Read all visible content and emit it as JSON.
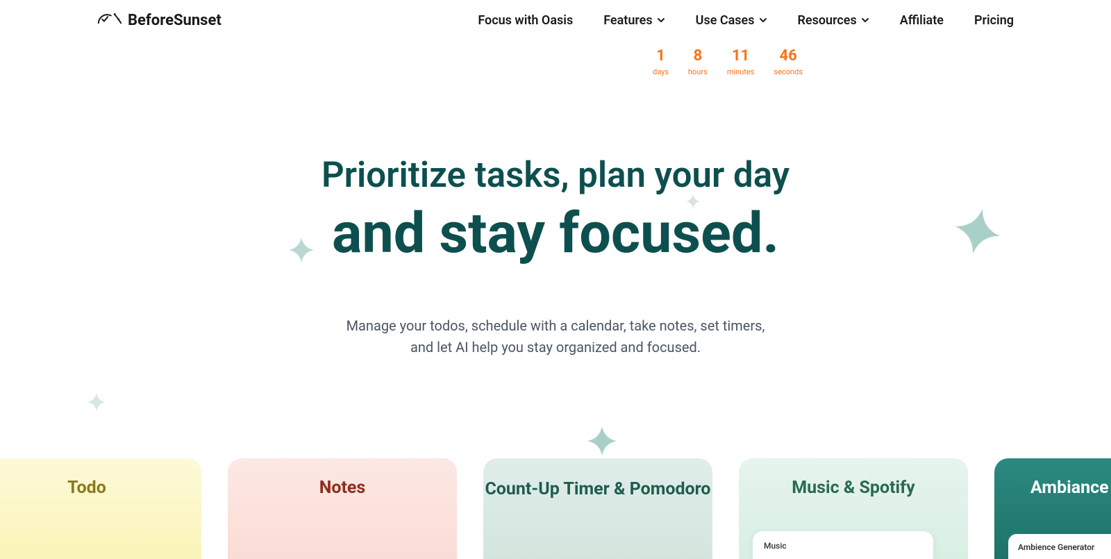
{
  "brand": {
    "name": "BeforeSunset"
  },
  "nav": {
    "items": [
      {
        "label": "Focus with Oasis",
        "dropdown": false
      },
      {
        "label": "Features",
        "dropdown": true
      },
      {
        "label": "Use Cases",
        "dropdown": true
      },
      {
        "label": "Resources",
        "dropdown": true
      },
      {
        "label": "Affiliate",
        "dropdown": false
      },
      {
        "label": "Pricing",
        "dropdown": false
      }
    ]
  },
  "countdown": {
    "days": {
      "value": "1",
      "label": "days"
    },
    "hours": {
      "value": "8",
      "label": "hours"
    },
    "minutes": {
      "value": "11",
      "label": "minutes"
    },
    "seconds": {
      "value": "46",
      "label": "seconds"
    }
  },
  "hero": {
    "line1": "Prioritize tasks, plan your day",
    "line2": "and stay focused.",
    "subtitle": "Manage your todos, schedule with a calendar, take notes, set timers, and let AI help you stay organized and focused."
  },
  "cards": {
    "todo": "Todo",
    "notes": "Notes",
    "timer": "Count-Up Timer & Pomodoro",
    "music": "Music & Spotify",
    "music_inner": "Music",
    "ambiance": "Ambiance G",
    "ambiance_inner": "Ambience Generator"
  }
}
